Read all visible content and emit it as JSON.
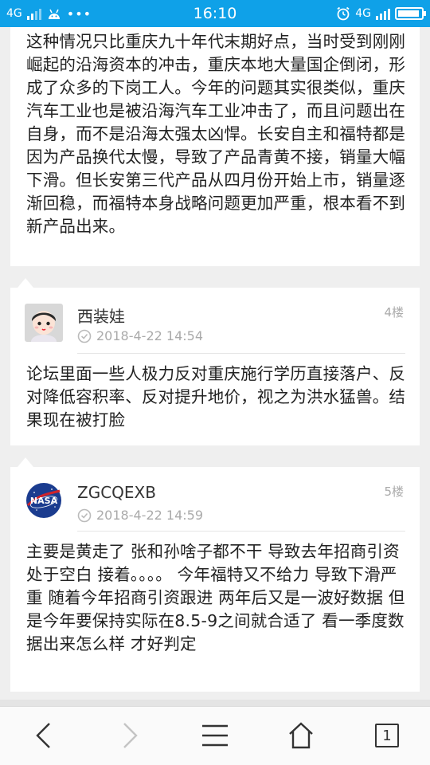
{
  "status_bar": {
    "network_left": "4G",
    "time": "16:10",
    "network_right": "4G"
  },
  "top_post": {
    "text": "这种情况只比重庆九十年代末期好点，当时受到刚刚崛起的沿海资本的冲击，重庆本地大量国企倒闭，形成了众多的下岗工人。今年的问题其实很类似，重庆汽车工业也是被沿海汽车工业冲击了，而且问题出在自身，而不是沿海太强太凶悍。长安自主和福特都是因为产品换代太慢，导致了产品青黄不接，销量大幅下滑。但长安第三代产品从四月份开始上市，销量逐渐回稳，而福特本身战略问题更加严重，根本看不到新产品出来。"
  },
  "posts": [
    {
      "username": "西装娃",
      "time": "2018-4-22 14:54",
      "floor": "4楼",
      "text": "论坛里面一些人极力反对重庆施行学历直接落户、反对降低容积率、反对提升地价，视之为洪水猛兽。结果现在被打脸",
      "avatar": "cartoon-face-avatar"
    },
    {
      "username": "ZGCQEXB",
      "time": "2018-4-22 14:59",
      "floor": "5楼",
      "text": "主要是黄走了 张和孙啥子都不干  导致去年招商引资处于空白 接着。。。。 今年福特又不给力 导致下滑严重  随着今年招商引资跟进 两年后又是一波好数据  但是今年要保持实际在8.5-9之间就合适了   看一季度数据出来怎么样  才好判定",
      "avatar": "nasa-logo-avatar"
    }
  ],
  "bottom_nav": {
    "page_count": "1"
  },
  "colors": {
    "status_bar": "#0fa1e8",
    "background": "#efefef",
    "card": "#ffffff"
  }
}
